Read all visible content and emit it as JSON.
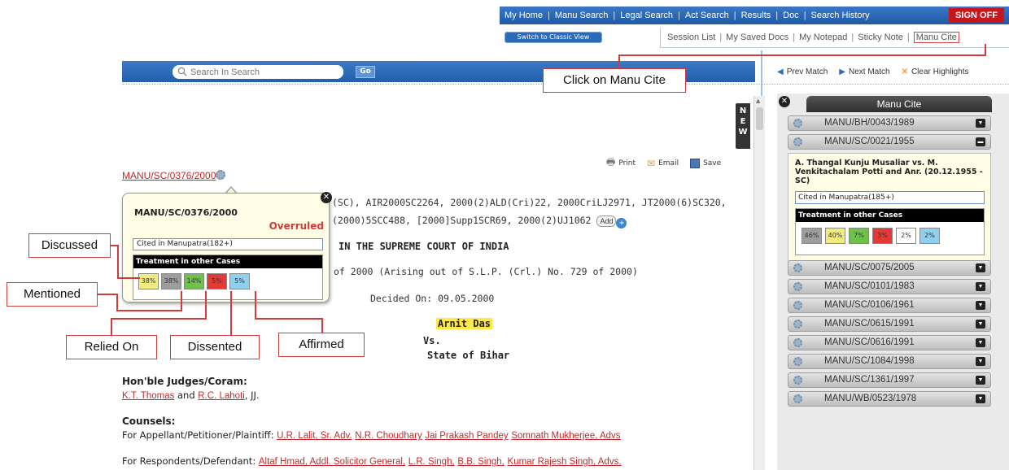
{
  "topnav": {
    "items": [
      "My Home",
      "Manu Search",
      "Legal Search",
      "Act Search",
      "Results",
      "Doc",
      "Search History"
    ],
    "signoff": "SIGN OFF",
    "classic_view": "Switch to Classic View"
  },
  "subnav": {
    "items": [
      "Session List",
      "My Saved Docs",
      "My Notepad",
      "Sticky Note",
      "Manu Cite"
    ]
  },
  "search": {
    "placeholder": "Search In Search",
    "go": "Go"
  },
  "match": {
    "prev": "Prev Match",
    "next": "Next Match",
    "clear": "Clear Highlights"
  },
  "callouts": {
    "manu_cite": "Click on Manu Cite",
    "discussed": "Discussed",
    "mentioned": "Mentioned",
    "relied_on": "Relied On",
    "dissented": "Dissented",
    "affirmed": "Affirmed"
  },
  "new_tab": [
    "N",
    "E",
    "W"
  ],
  "doc": {
    "print": "Print",
    "email": "Email",
    "save": "Save",
    "citation_id": "MANU/SC/0376/2000",
    "citations_line1": "(SC), AIR2000SC2264, 2000(2)ALD(Cri)22, 2000CriLJ2971, JT2000(6)SC320,",
    "citations_line2": "(2000)5SCC488, [2000]Supp1SCR69, 2000(2)UJ1062",
    "add": "Add",
    "court": "IN THE SUPREME COURT OF INDIA",
    "case_no": "of 2000 (Arising out of S.L.P. (Crl.) No. 729 of 2000)",
    "decided": "Decided On: 09.05.2000",
    "party1": "Arnit Das",
    "vs": "Vs.",
    "party2": "State of Bihar",
    "judges_heading": "Hon'ble Judges/Coram:",
    "judge1": "K.T. Thomas",
    "and": " and ",
    "judge2": "R.C. Lahoti",
    "jj": ", JJ.",
    "counsels_heading": "Counsels:",
    "appellant_label": "For Appellant/Petitioner/Plaintiff: ",
    "appellant_counsels": [
      "U.R. Lalit, Sr. Adv.",
      "N.R. Choudhary",
      "Jai Prakash Pandey",
      "Somnath Mukherjee, Advs"
    ],
    "respondent_label": "For Respondents/Defendant: ",
    "respondent_counsels": [
      "Altaf Hmad, Addl. Solicitor General,",
      "L.R. Singh,",
      "B.B. Singh,",
      "Kumar Rajesh Singh, Advs."
    ]
  },
  "popup": {
    "title": "MANU/SC/0376/2000",
    "status": "Overruled",
    "cited": "Cited in Manupatra(182+)",
    "treatment_heading": "Treatment in other Cases",
    "cells": [
      {
        "label": "38%",
        "color": "#f3ec7a"
      },
      {
        "label": "38%",
        "color": "#9d9d9d"
      },
      {
        "label": "14%",
        "color": "#6ec24a"
      },
      {
        "label": "5%",
        "color": "#e53935"
      },
      {
        "label": "5%",
        "color": "#8fd0ee"
      }
    ]
  },
  "manu_cite": {
    "title": "Manu Cite",
    "rows_top": [
      "MANU/BH/0043/1989",
      "MANU/SC/0021/1955"
    ],
    "expanded": {
      "title": "A. Thangal Kunju Musaliar vs. M. Venkitachalam Potti and Anr. (20.12.1955 - SC)",
      "cited": "Cited in Manupatra(185+)",
      "treatment_heading": "Treatment in other Cases",
      "cells": [
        {
          "label": "46%",
          "color": "#9d9d9d"
        },
        {
          "label": "40%",
          "color": "#f3ec7a"
        },
        {
          "label": "7%",
          "color": "#6ec24a"
        },
        {
          "label": "3%",
          "color": "#e53935"
        },
        {
          "label": "2%",
          "color": "#ffffff"
        },
        {
          "label": "2%",
          "color": "#8fd0ee"
        }
      ]
    },
    "rows_bottom": [
      "MANU/SC/0075/2005",
      "MANU/SC/0101/1983",
      "MANU/SC/0106/1961",
      "MANU/SC/0615/1991",
      "MANU/SC/0616/1991",
      "MANU/SC/1084/1998",
      "MANU/SC/1361/1997",
      "MANU/WB/0523/1978"
    ]
  }
}
